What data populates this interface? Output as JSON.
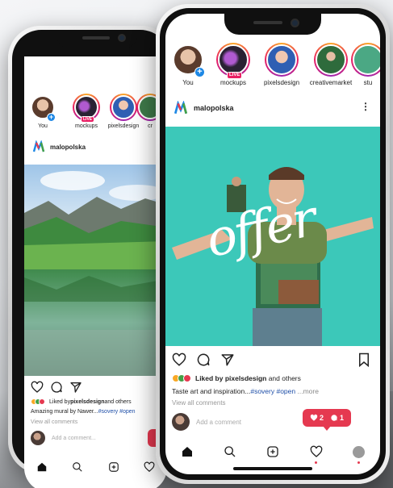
{
  "back_phone": {
    "stories": [
      {
        "label": "You",
        "badge": "plus"
      },
      {
        "label": "mockups",
        "badge": "LIVE"
      },
      {
        "label": "pixelsdesign",
        "badge": ""
      },
      {
        "label": "cr",
        "badge": ""
      }
    ],
    "post": {
      "author": "malopolska",
      "liked_by_prefix": "Liked by ",
      "liked_by_user": "pixelsdesign",
      "liked_by_suffix": " and others",
      "caption_text": "Amazing mural by Nawer...",
      "caption_tag": "#sovery #open",
      "view_comments": "View all comments",
      "comment_placeholder": "Add a comment..."
    }
  },
  "front_phone": {
    "stories": [
      {
        "label": "You",
        "badge": "plus"
      },
      {
        "label": "mockups",
        "badge": "LIVE"
      },
      {
        "label": "pixelsdesign",
        "badge": ""
      },
      {
        "label": "creativemarket",
        "badge": ""
      },
      {
        "label": "stu",
        "badge": ""
      }
    ],
    "post": {
      "author": "malopolska",
      "image_text": "offer",
      "liked_by_prefix": "Liked by ",
      "liked_by_user": "pixelsdesign",
      "liked_by_suffix": " and others",
      "caption_text": "Taste art and inspiration...",
      "caption_tag": "#sovery #open",
      "caption_more": "...more",
      "view_comments": "View all comments",
      "comment_placeholder": "Add a comment"
    },
    "notifications": {
      "likes": "2",
      "comments": "1"
    }
  },
  "colors": {
    "accent_red": "#e53950",
    "story_gradient": [
      "#f9a825",
      "#e91e63",
      "#9c27b0"
    ],
    "post_background": "#3cc8b9"
  },
  "icons": {
    "nav": [
      "home-icon",
      "search-icon",
      "add-icon",
      "heart-icon",
      "profile-icon"
    ],
    "actions": [
      "heart-icon",
      "comment-icon",
      "share-icon",
      "bookmark-icon"
    ]
  }
}
